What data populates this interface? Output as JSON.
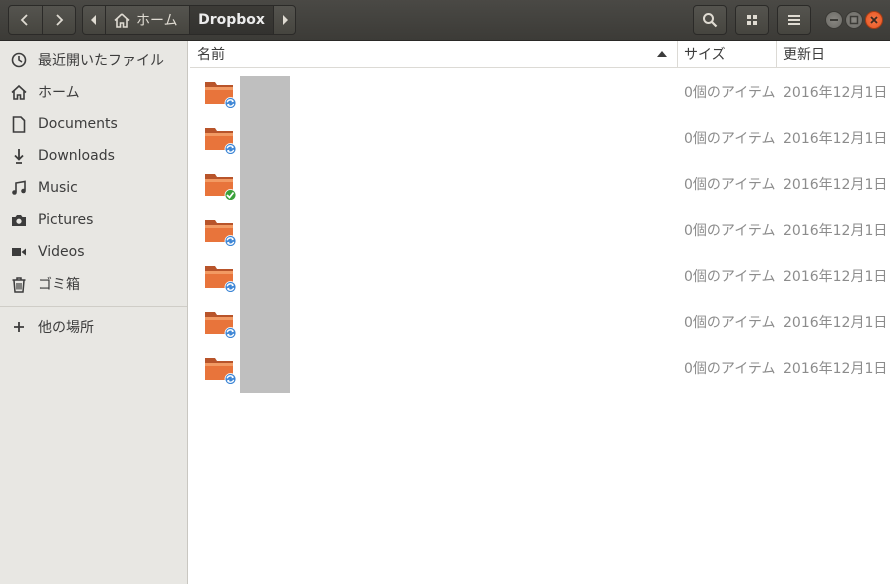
{
  "header": {
    "path": {
      "home_label": "ホーム",
      "current_label": "Dropbox"
    },
    "icons": [
      "back-icon",
      "forward-icon",
      "search-icon",
      "view-grid-icon",
      "menu-icon"
    ]
  },
  "sidebar": {
    "items": [
      {
        "label": "最近開いたファイル",
        "icon": "recent-icon"
      },
      {
        "label": "ホーム",
        "icon": "home-icon"
      },
      {
        "label": "Documents",
        "icon": "document-icon"
      },
      {
        "label": "Downloads",
        "icon": "download-icon"
      },
      {
        "label": "Music",
        "icon": "music-icon"
      },
      {
        "label": "Pictures",
        "icon": "camera-icon"
      },
      {
        "label": "Videos",
        "icon": "video-icon"
      },
      {
        "label": "ゴミ箱",
        "icon": "trash-icon"
      }
    ],
    "other_locations": {
      "label": "他の場所",
      "icon": "plus-icon"
    }
  },
  "list": {
    "columns": {
      "name": "名前",
      "size": "サイズ",
      "modified": "更新日"
    },
    "rows": [
      {
        "count": "0個のアイテム",
        "date": "2016年12月1日",
        "status": "syncing"
      },
      {
        "count": "0個のアイテム",
        "date": "2016年12月1日",
        "status": "syncing"
      },
      {
        "count": "0個のアイテム",
        "date": "2016年12月1日",
        "status": "synced"
      },
      {
        "count": "0個のアイテム",
        "date": "2016年12月1日",
        "status": "syncing"
      },
      {
        "count": "0個のアイテム",
        "date": "2016年12月1日",
        "status": "syncing"
      },
      {
        "count": "0個のアイテム",
        "date": "2016年12月1日",
        "status": "syncing"
      },
      {
        "count": "0個のアイテム",
        "date": "2016年12月1日",
        "status": "syncing"
      }
    ]
  },
  "colors": {
    "accent_close": "#e95420",
    "folder": "#e8743b",
    "sync_blue": "#3d86d6",
    "sync_green": "#3aa13a"
  }
}
